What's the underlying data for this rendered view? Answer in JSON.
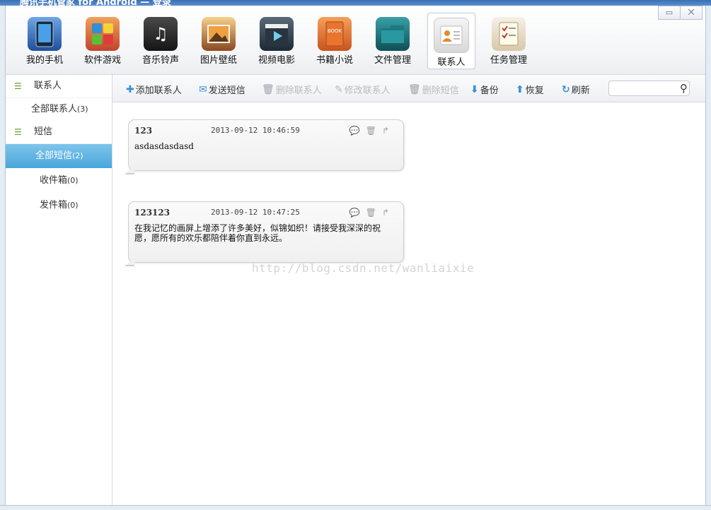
{
  "window": {
    "title": "腾讯手机管家 for Android — 登录",
    "buttons": {
      "minimize": "▭",
      "close": "⨉"
    }
  },
  "topnav": [
    {
      "label": "我的手机",
      "icon": "phone-icon",
      "color": "#3b6fb5"
    },
    {
      "label": "软件游戏",
      "icon": "apps-icon",
      "color": "#d06a2e"
    },
    {
      "label": "音乐铃声",
      "icon": "music-icon",
      "color": "#2a2a2a"
    },
    {
      "label": "图片壁纸",
      "icon": "picture-icon",
      "color": "#b87a3a"
    },
    {
      "label": "视频电影",
      "icon": "video-icon",
      "color": "#2f4f66"
    },
    {
      "label": "书籍小说",
      "icon": "book-icon",
      "color": "#d46a2a"
    },
    {
      "label": "文件管理",
      "icon": "folder-icon",
      "color": "#1f6f76"
    },
    {
      "label": "联系人",
      "icon": "contact-icon",
      "color": "#e8882d",
      "active": true
    },
    {
      "label": "任务管理",
      "icon": "task-icon",
      "color": "#c0392b"
    }
  ],
  "sidebar": {
    "contacts_group": "联系人",
    "all_contacts": "全部联系人",
    "all_contacts_count": "(3)",
    "sms_group": "短信",
    "all_sms": "全部短信",
    "all_sms_count": "(2)",
    "inbox": "收件箱",
    "inbox_count": "(0)",
    "outbox": "发件箱",
    "outbox_count": "(0)"
  },
  "toolbar": {
    "add_contact": "添加联系人",
    "send_sms": "发送短信",
    "delete_contact": "删除联系人",
    "edit_contact": "修改联系人",
    "delete_sms": "删除短信",
    "backup": "备份",
    "restore": "恢复",
    "refresh": "刷新",
    "search_placeholder": ""
  },
  "messages": [
    {
      "sender": "123",
      "time": "2013-09-12 10:46:59",
      "text": "asdasdasdasd"
    },
    {
      "sender": "123123",
      "time": "2013-09-12 10:47:25",
      "text": "在我记忆的画屏上增添了许多美好，似锦如织！请接受我深深的祝愿，愿所有的欢乐都陪伴着你直到永远。"
    }
  ],
  "watermark": "http://blog.csdn.net/wanliaixie",
  "colors": {
    "accent": "#49a6dc",
    "list_bullet": "#6a9a2e",
    "toolbar_blue": "#3b8fd0"
  }
}
